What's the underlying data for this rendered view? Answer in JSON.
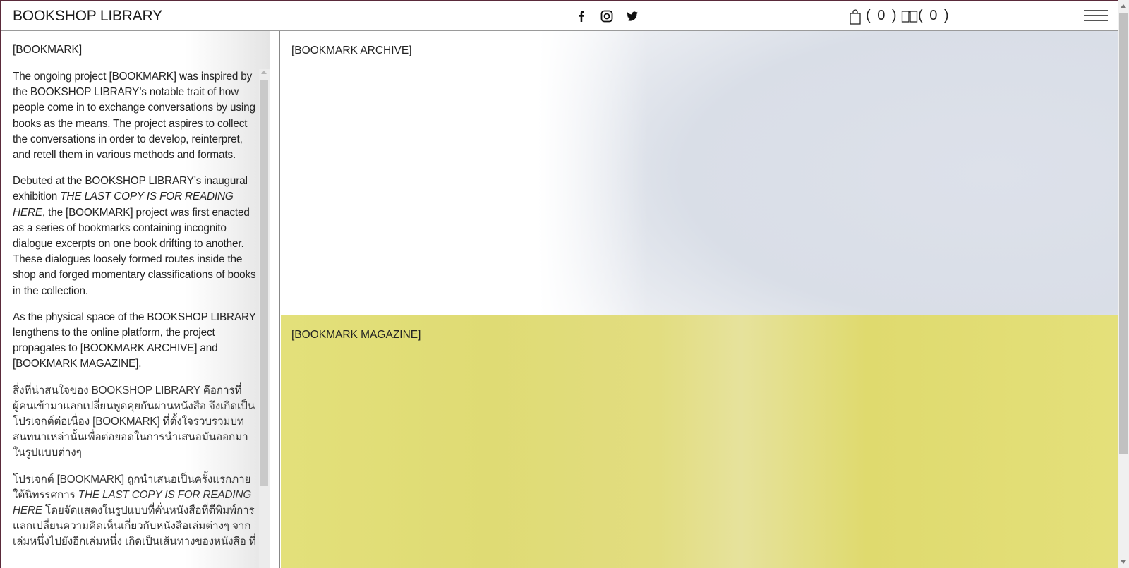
{
  "header": {
    "brand": "BOOKSHOP LIBRARY",
    "social": [
      "facebook-icon",
      "instagram-icon",
      "twitter-icon"
    ],
    "cart_count": "( 0 )",
    "borrow_count": "( 0 )",
    "menu_icon": "hamburger-icon"
  },
  "left": {
    "title": "[BOOKMARK]",
    "p1": "The ongoing project [BOOKMARK] was inspired by the BOOKSHOP LIBRARY’s notable trait of how people come in to exchange conversations by using books as the means. The project aspires to collect the conversations in order to develop, reinterpret, and retell them in various methods and formats.",
    "p2_a": "Debuted at the BOOKSHOP LIBRARY’s inaugural exhibition ",
    "p2_em": "THE LAST COPY IS FOR READING HERE",
    "p2_b": ", the [BOOKMARK] project was first enacted as a series of bookmarks containing incognito dialogue excerpts on one book drifting to another. These dialogues loosely formed routes inside the shop and forged momentary classifications of books in the collection.",
    "p3": "As the physical space of the BOOKSHOP LIBRARY lengthens to the online platform, the project propagates to [BOOKMARK ARCHIVE] and [BOOKMARK MAGAZINE].",
    "p4": "สิ่งที่น่าสนใจของ BOOKSHOP LIBRARY คือการที่ผู้คนเข้ามาแลกเปลี่ยนพูดคุยกันผ่านหนังสือ จึงเกิดเป็นโปรเจกต์ต่อเนื่อง [BOOKMARK] ที่ตั้งใจรวบรวมบทสนทนาเหล่านั้นเพื่อต่อยอดในการนำเสนอมันออกมาในรูปแบบต่างๆ",
    "p5_a": "โปรเจกต์ [BOOKMARK] ถูกนำเสนอเป็นครั้งแรกภายใต้นิทรรศการ ",
    "p5_em": "THE LAST COPY IS FOR READING HERE",
    "p5_b": " โดยจัดแสดงในรูปแบบที่คั่นหนังสือที่ตีพิมพ์การแลกเปลี่ยนความคิดเห็นเกี่ยวกับหนังสือเล่มต่างๆ จากเล่มหนึ่งไปยังอีกเล่มหนึ่ง เกิดเป็นเส้นทางของหนังสือ ที่"
  },
  "archive": {
    "title": "[BOOKMARK ARCHIVE]"
  },
  "magazine": {
    "title": "[BOOKMARK MAGAZINE]"
  },
  "colors": {
    "magazine_bg": "#e3e07a",
    "archive_bg": "#dde1ea",
    "frame": "#5a2a3a"
  }
}
